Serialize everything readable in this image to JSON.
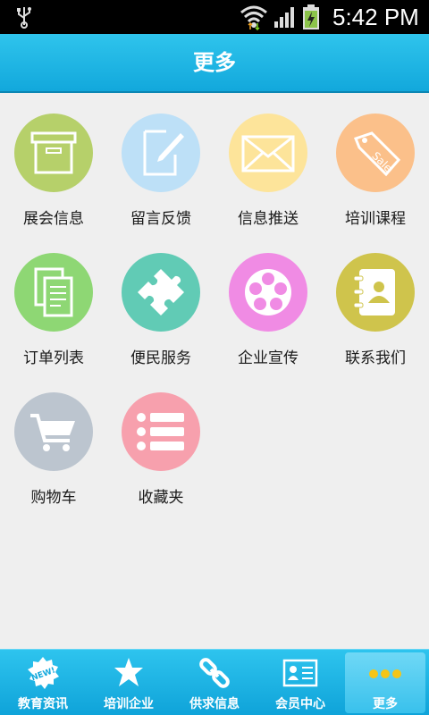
{
  "status_bar": {
    "time": "5:42 PM",
    "icons": [
      "usb-icon",
      "wifi-icon",
      "signal-icon",
      "battery-charging-icon"
    ]
  },
  "header": {
    "title": "更多"
  },
  "grid": [
    {
      "label": "展会信息",
      "icon": "box-icon",
      "color": "#b6d06a"
    },
    {
      "label": "留言反馈",
      "icon": "edit-icon",
      "color": "#bde0f7"
    },
    {
      "label": "信息推送",
      "icon": "envelope-icon",
      "color": "#fde49a"
    },
    {
      "label": "培训课程",
      "icon": "sale-tag-icon",
      "color": "#fbc08a"
    },
    {
      "label": "订单列表",
      "icon": "documents-icon",
      "color": "#8ed774"
    },
    {
      "label": "便民服务",
      "icon": "puzzle-icon",
      "color": "#61cbb5"
    },
    {
      "label": "企业宣传",
      "icon": "film-reel-icon",
      "color": "#f08be4"
    },
    {
      "label": "联系我们",
      "icon": "contacts-book-icon",
      "color": "#cfc44c"
    },
    {
      "label": "购物车",
      "icon": "cart-icon",
      "color": "#bcc5cf"
    },
    {
      "label": "收藏夹",
      "icon": "list-icon",
      "color": "#f7a0ad"
    }
  ],
  "tabbar": {
    "items": [
      {
        "label": "教育资讯",
        "icon": "new-badge-icon",
        "active": false
      },
      {
        "label": "培训企业",
        "icon": "star-icon",
        "active": false
      },
      {
        "label": "供求信息",
        "icon": "link-icon",
        "active": false
      },
      {
        "label": "会员中心",
        "icon": "member-card-icon",
        "active": false
      },
      {
        "label": "更多",
        "icon": "more-dots-icon",
        "active": true
      }
    ],
    "new_badge_text": "NEW!"
  }
}
